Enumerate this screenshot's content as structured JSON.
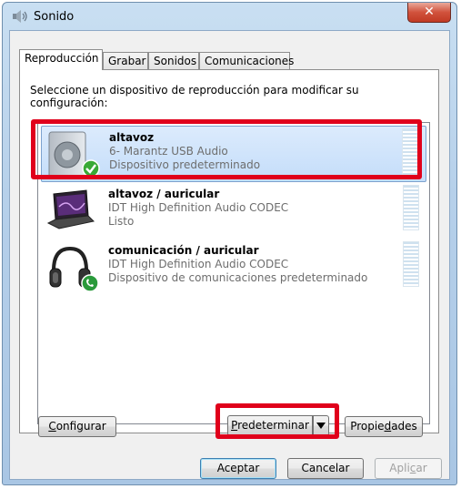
{
  "window": {
    "title": "Sonido",
    "close_glyph": "✕"
  },
  "tabs": [
    {
      "label": "Reproducción",
      "active": true
    },
    {
      "label": "Grabar",
      "active": false
    },
    {
      "label": "Sonidos",
      "active": false
    },
    {
      "label": "Comunicaciones",
      "active": false
    }
  ],
  "instruction": "Seleccione un dispositivo de reproducción para modificar su configuración:",
  "devices": [
    {
      "name": "altavoz",
      "line2": "6- Marantz USB Audio",
      "line3": "Dispositivo predeterminado",
      "icon": "speaker-icon",
      "badge": "check-badge",
      "selected": true
    },
    {
      "name": "altavoz / auricular",
      "line2": "IDT High Definition Audio CODEC",
      "line3": "Listo",
      "icon": "laptop-icon",
      "selected": false
    },
    {
      "name": "comunicación  / auricular",
      "line2": "IDT High Definition Audio CODEC",
      "line3": "Dispositivo de comunicaciones predeterminado",
      "icon": "headphones-icon",
      "badge": "phone-badge",
      "selected": false
    }
  ],
  "buttons": {
    "configure_pre": "",
    "configure_acc": "C",
    "configure_post": "onfigurar",
    "default_pre": "",
    "default_acc": "P",
    "default_post": "redeterminar",
    "props_pre": "Propie",
    "props_acc": "d",
    "props_post": "ades",
    "ok": "Aceptar",
    "cancel": "Cancelar",
    "apply_pre": "Apli",
    "apply_acc": "c",
    "apply_post": "ar"
  },
  "colors": {
    "highlight": "#e0001b",
    "selection": "#c4ddfa",
    "accent": "#3c7fb1"
  }
}
